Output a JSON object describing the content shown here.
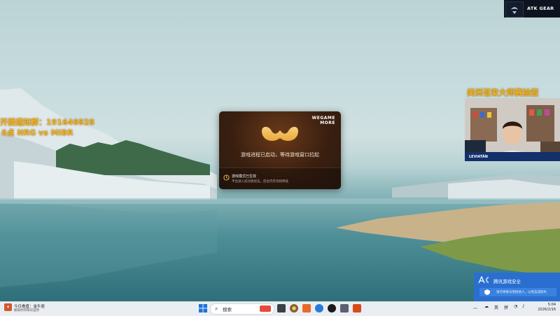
{
  "overlay": {
    "left_line1": "开播通知群：191646828",
    "left_line2": "6点 NRG vs MIBR",
    "right_title": "美洲결束大师赛抽签"
  },
  "top_right": {
    "brand_text": "ATK GEAR"
  },
  "wegame_popup": {
    "brand_line1": "WEGAME",
    "brand_line2": "MORE",
    "message": "游戏进程已启动，等待游戏窗口拉起",
    "status_title": "游戏模式已生效",
    "status_sub": "平台进入低功耗状态，后台内存消耗降低"
  },
  "webcam": {
    "streamer_name": "LEVIATÁN"
  },
  "security_toast": {
    "title": "腾讯游戏安全",
    "body": "请勿将账号借给他人，以免造成损失"
  },
  "taskbar": {
    "news_title": "今日看盘：金牛座",
    "news_sub": "解锁你的每日运势",
    "search_placeholder": "搜索",
    "tray_lang": "英",
    "tray_ime": "拼",
    "time": "5:04",
    "date": "2026/2/16"
  },
  "colors": {
    "overlay_text": "#f0b323",
    "security_blue": "#2a6fd0",
    "taskbar_bg": "#eaeef2"
  }
}
